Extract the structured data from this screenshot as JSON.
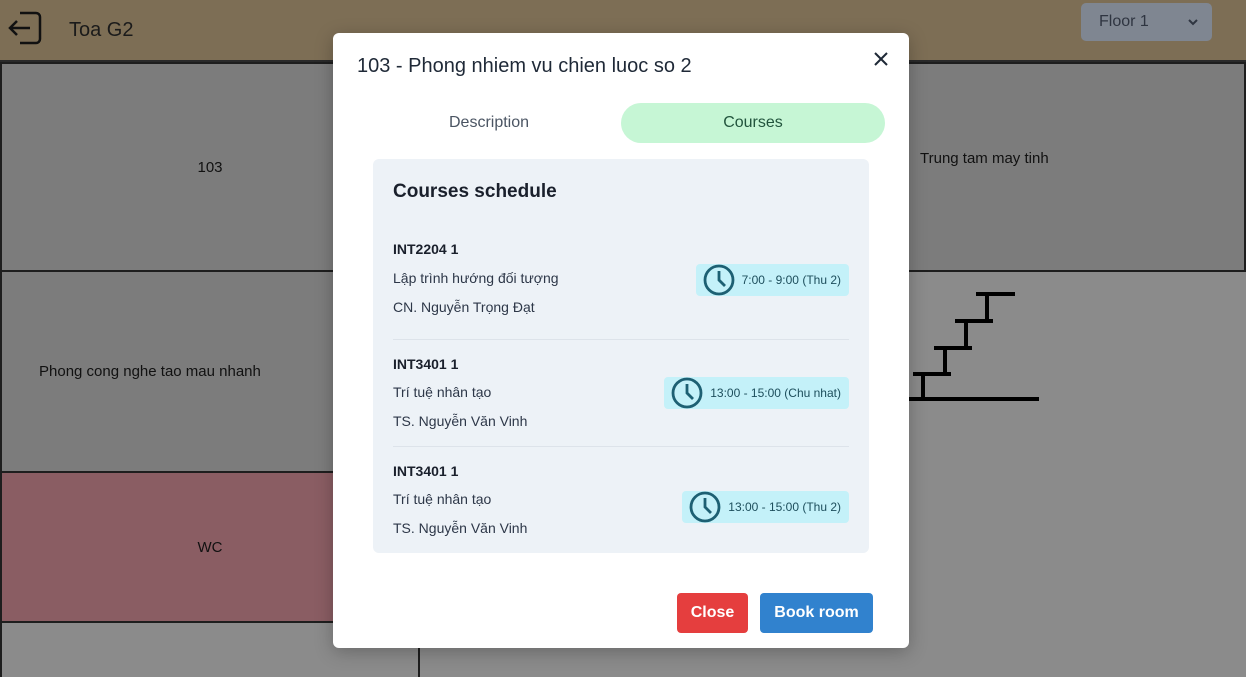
{
  "header": {
    "title": "Toa G2",
    "floor_select": "Floor 1"
  },
  "rooms": {
    "r103": "103",
    "r_lab": "Trung tam may tinh",
    "r_rapid": "Phong cong nghe tao mau nhanh",
    "r_wc": "WC"
  },
  "modal": {
    "title": "103 - Phong nhiem vu chien luoc so 2",
    "tabs": [
      {
        "label": "Description",
        "active": false
      },
      {
        "label": "Courses",
        "active": true
      }
    ],
    "schedule_title": "Courses schedule",
    "courses": [
      {
        "code": "INT2204 1",
        "name": "Lập trình hướng đối tượng",
        "teacher": "CN. Nguyễn Trọng Đạt",
        "time": "7:00 - 9:00 (Thu 2)"
      },
      {
        "code": "INT3401 1",
        "name": "Trí tuệ nhân tạo",
        "teacher": "TS. Nguyễn Văn Vinh",
        "time": "13:00 - 15:00 (Chu nhat)"
      },
      {
        "code": "INT3401 1",
        "name": "Trí tuệ nhân tạo",
        "teacher": "TS. Nguyễn Văn Vinh",
        "time": "13:00 - 15:00 (Thu 2)"
      }
    ],
    "buttons": {
      "close": "Close",
      "book": "Book room"
    }
  },
  "colors": {
    "header_bg": "#7d6e55",
    "tab_active": "#c6f6d5",
    "badge_bg": "#c4f1f9",
    "close_btn": "#e53e3e",
    "book_btn": "#3182ce"
  },
  "icons": [
    "back-arrow-icon",
    "chevron-down-icon",
    "close-icon",
    "clock-icon"
  ]
}
